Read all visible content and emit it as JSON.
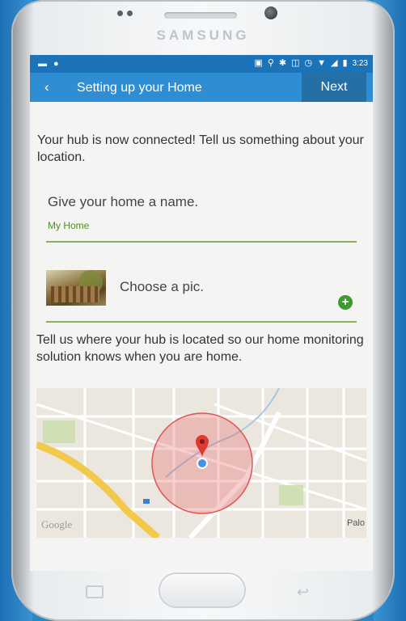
{
  "device": {
    "brand": "SAMSUNG"
  },
  "status_bar": {
    "time": "3:23"
  },
  "app_bar": {
    "back_icon": "chevron-left-icon",
    "title": "Setting up your Home",
    "next_label": "Next"
  },
  "content": {
    "intro": "Your hub is now connected! Tell us something about your location.",
    "name_label": "Give your home a name.",
    "name_value": "My Home",
    "pic_label": "Choose a pic.",
    "location_text": "Tell us where your hub is located so our home monitoring solution knows when you are home."
  },
  "map": {
    "label": "Palo",
    "attribution": "Google"
  },
  "colors": {
    "status_bar": "#1d73b7",
    "app_bar": "#2f8ed3",
    "next_button": "#246fa6",
    "accent_green": "#3f9a33",
    "underline": "#8bb05f"
  }
}
